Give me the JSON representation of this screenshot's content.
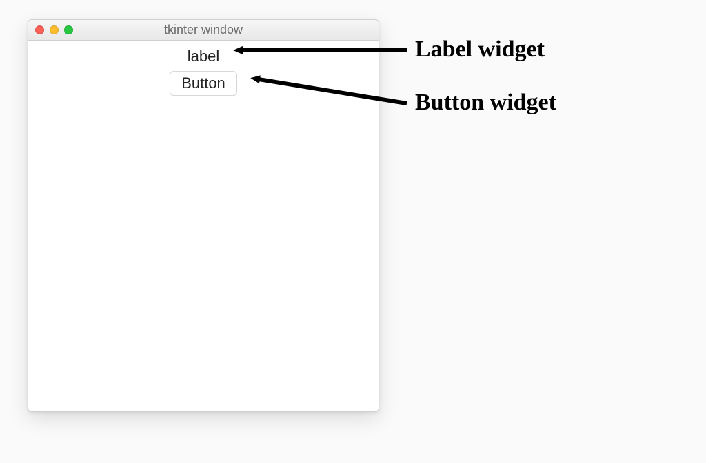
{
  "window": {
    "title": "tkinter window",
    "label_text": "label",
    "button_text": "Button"
  },
  "annotations": {
    "label_caption": "Label widget",
    "button_caption": "Button widget"
  }
}
